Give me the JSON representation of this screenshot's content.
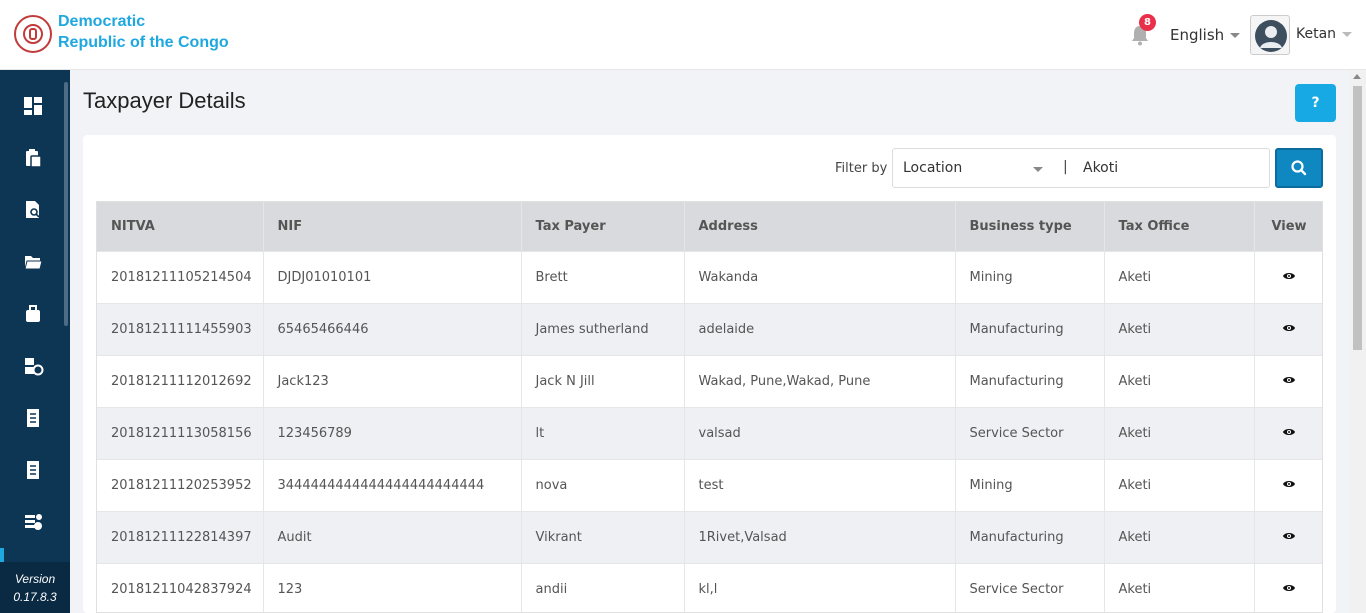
{
  "header": {
    "brand": "Democratic\nRepublic of the Congo",
    "brand_line1": "Democratic",
    "brand_line2": "Republic of the Congo",
    "notification_count": "8",
    "language": "English",
    "username": "Ketan"
  },
  "sidebar": {
    "icons": [
      "dashboard-icon",
      "clipboard-icon",
      "document-search-icon",
      "folder-icon",
      "briefcase-icon",
      "user-settings-icon",
      "receipt-icon",
      "receipt-icon",
      "list-settings-icon"
    ],
    "version_label": "Version",
    "version_number": "0.17.8.3"
  },
  "page": {
    "title": "Taxpayer Details",
    "help_label": "?"
  },
  "filter": {
    "label": "Filter by",
    "field": "Location",
    "separator": "|",
    "value": "Akoti"
  },
  "table": {
    "headers": [
      "NITVA",
      "NIF",
      "Tax Payer",
      "Address",
      "Business type",
      "Tax Office",
      "View"
    ],
    "rows": [
      [
        "20181211105214504",
        "DJDJ01010101",
        "Brett",
        "Wakanda",
        "Mining",
        "Aketi"
      ],
      [
        "20181211111455903",
        "65465466446",
        "James sutherland",
        "adelaide",
        "Manufacturing",
        "Aketi"
      ],
      [
        "20181211112012692",
        "Jack123",
        "Jack N Jill",
        "Wakad, Pune,Wakad, Pune",
        "Manufacturing",
        "Aketi"
      ],
      [
        "20181211113058156",
        "123456789",
        "lt",
        "valsad",
        "Service Sector",
        "Aketi"
      ],
      [
        "20181211120253952",
        "3444444444444444444444444",
        "nova",
        "test",
        "Mining",
        "Aketi"
      ],
      [
        "20181211122814397",
        "Audit",
        "Vikrant",
        "1Rivet,Valsad",
        "Manufacturing",
        "Aketi"
      ],
      [
        "20181211042837924",
        "123",
        "andii",
        "kl,l",
        "Service Sector",
        "Aketi"
      ]
    ]
  },
  "colors": {
    "brand": "#1fa8e0",
    "sidebar": "#0d3554",
    "badge": "#e8304a",
    "search_button": "#0f87c1",
    "help_button": "#17a9e4"
  }
}
